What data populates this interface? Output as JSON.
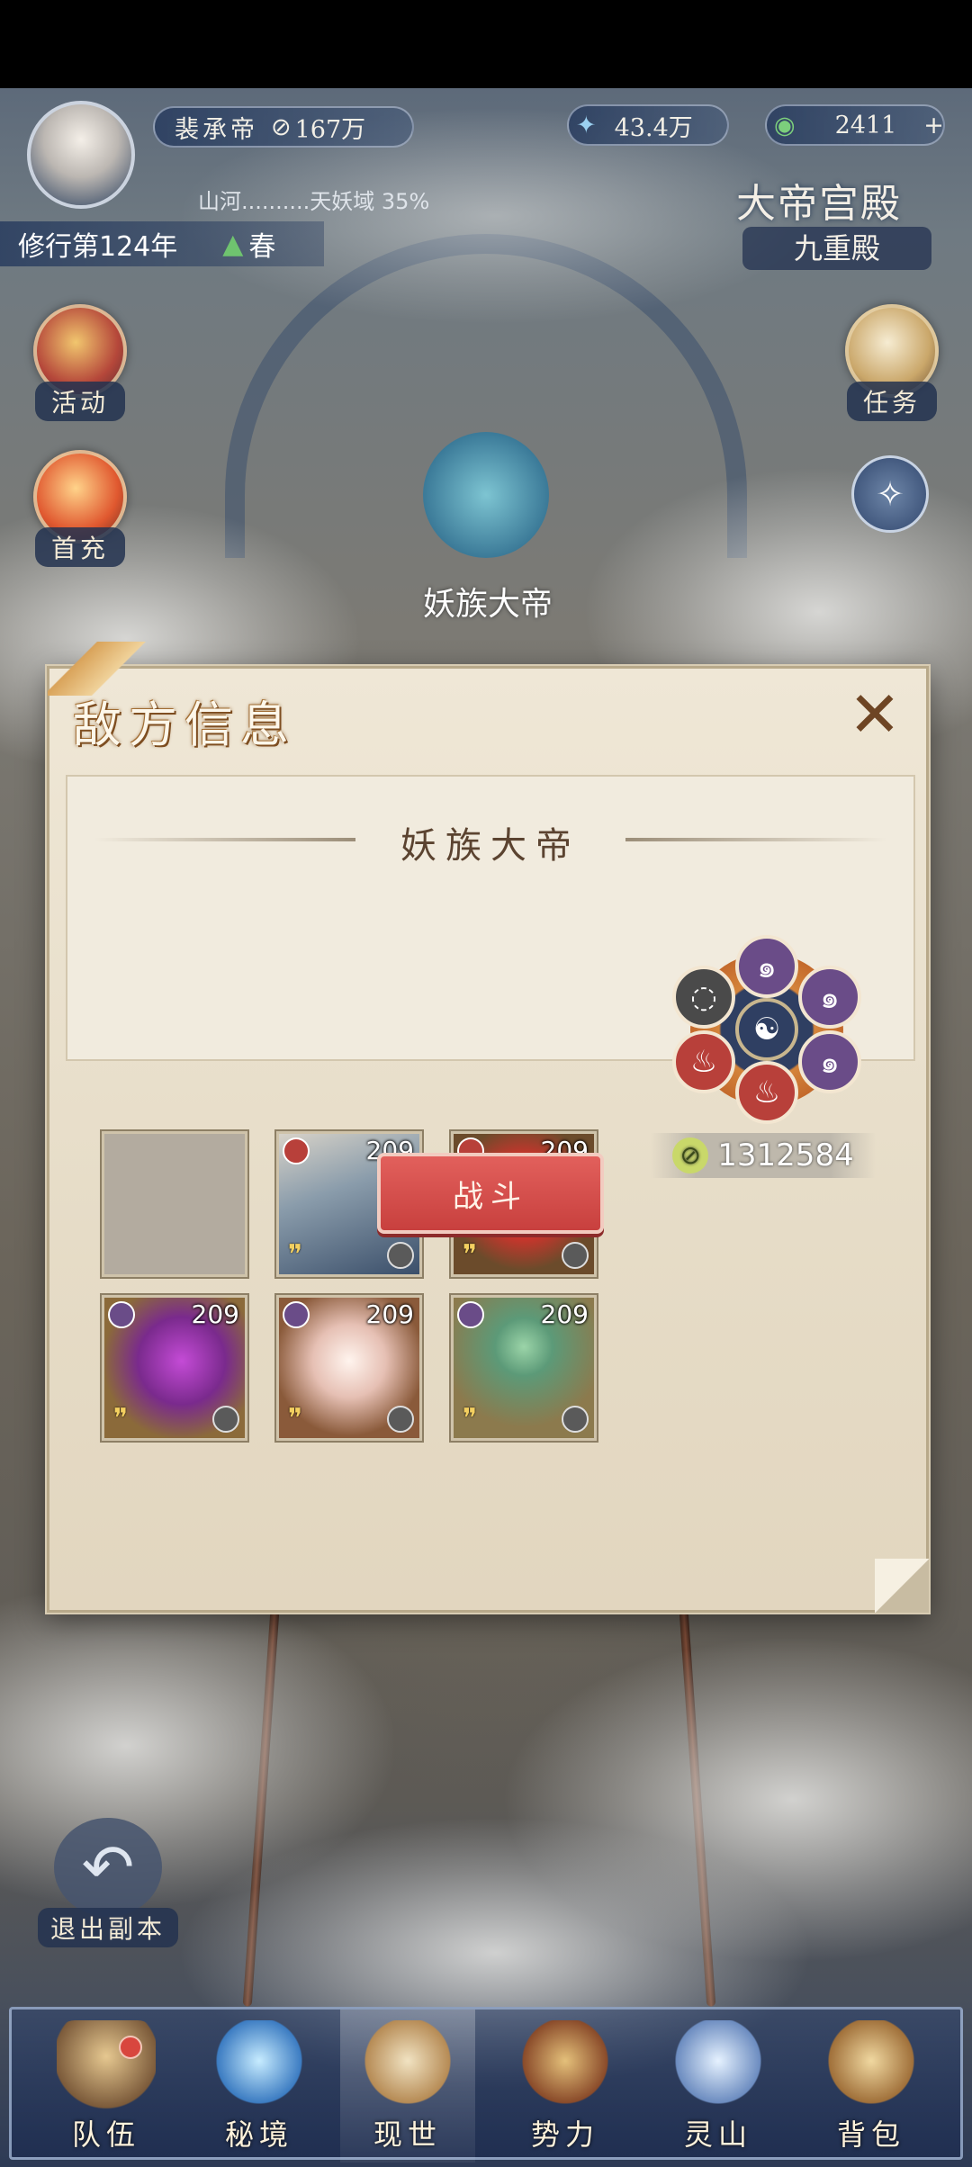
{
  "header": {
    "title_name": "裴承帝",
    "title_power": "167万",
    "currency_spirit": "43.4万",
    "currency_jade": "2411",
    "progress_text": "山河..........天妖域 35%",
    "cultivation_year": "修行第124年",
    "season": "春",
    "palace_title": "大帝宫殿",
    "palace_subtitle": "九重殿"
  },
  "side_buttons": {
    "activity": "活动",
    "first_recharge": "首充",
    "task": "任务",
    "exit_dungeon": "退出副本"
  },
  "boss_label": "妖族大帝",
  "panel": {
    "title": "敌方信息",
    "enemy_name": "妖族大帝",
    "slots": [
      {
        "level": "",
        "empty": true
      },
      {
        "level": "209",
        "element": "fire",
        "art": "hero-warrior"
      },
      {
        "level": "209",
        "element": "fire",
        "art": "red-crystal"
      },
      {
        "level": "209",
        "element": "spirit",
        "art": "purple-crescent"
      },
      {
        "level": "209",
        "element": "spirit",
        "art": "white-lotus"
      },
      {
        "level": "209",
        "element": "spirit",
        "art": "green-lotus"
      }
    ],
    "power_value": "1312584",
    "fight_label": "战斗"
  },
  "nav": [
    "队伍",
    "秘境",
    "现世",
    "势力",
    "灵山",
    "背包"
  ],
  "colors": {
    "fire": "#b8403a",
    "spirit": "#6a4c88",
    "fight_button": "#d44f4b",
    "panel_bg": "#ece4d3"
  }
}
